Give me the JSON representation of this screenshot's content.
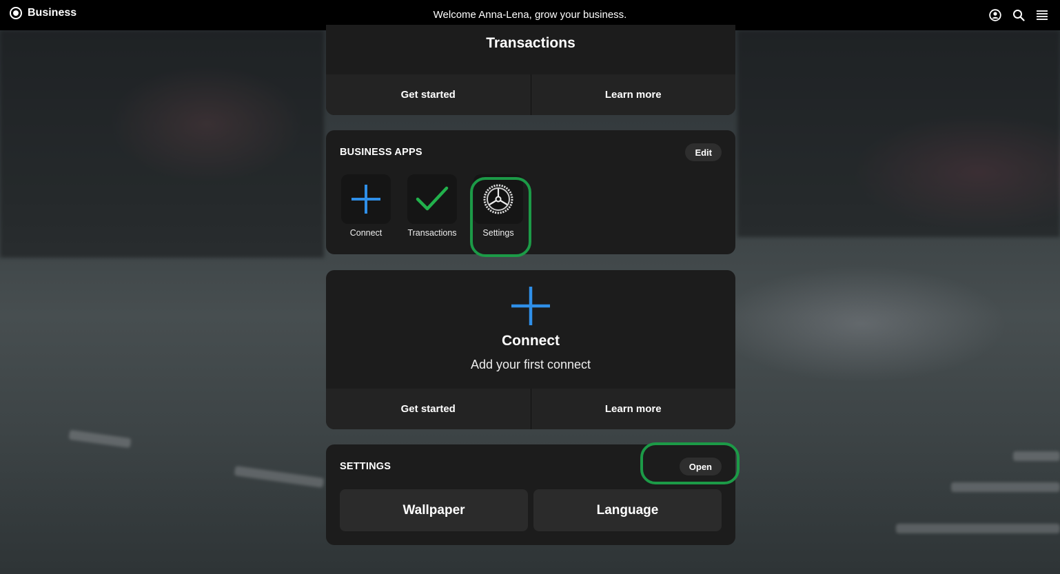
{
  "topbar": {
    "brand": "Business",
    "welcome": "Welcome Anna-Lena, grow your business.",
    "icons": [
      "account-icon",
      "search-icon",
      "menu-icon"
    ]
  },
  "transactions_card": {
    "title": "Transactions",
    "get_started": "Get started",
    "learn_more": "Learn more"
  },
  "business_apps": {
    "label": "BUSINESS APPS",
    "edit": "Edit",
    "apps": [
      {
        "label": "Connect",
        "icon": "plus-icon"
      },
      {
        "label": "Transactions",
        "icon": "checkmark-icon"
      },
      {
        "label": "Settings",
        "icon": "gear-icon"
      }
    ]
  },
  "connect_card": {
    "title": "Connect",
    "subtitle": "Add your first connect",
    "get_started": "Get started",
    "learn_more": "Learn more"
  },
  "settings_card": {
    "label": "SETTINGS",
    "open": "Open",
    "buttons": [
      "Wallpaper",
      "Language"
    ]
  },
  "colors": {
    "accent_blue": "#2f8fe8",
    "check_green": "#22b14c",
    "highlight_green": "#1c9a47",
    "card_bg": "#1c1c1c"
  }
}
